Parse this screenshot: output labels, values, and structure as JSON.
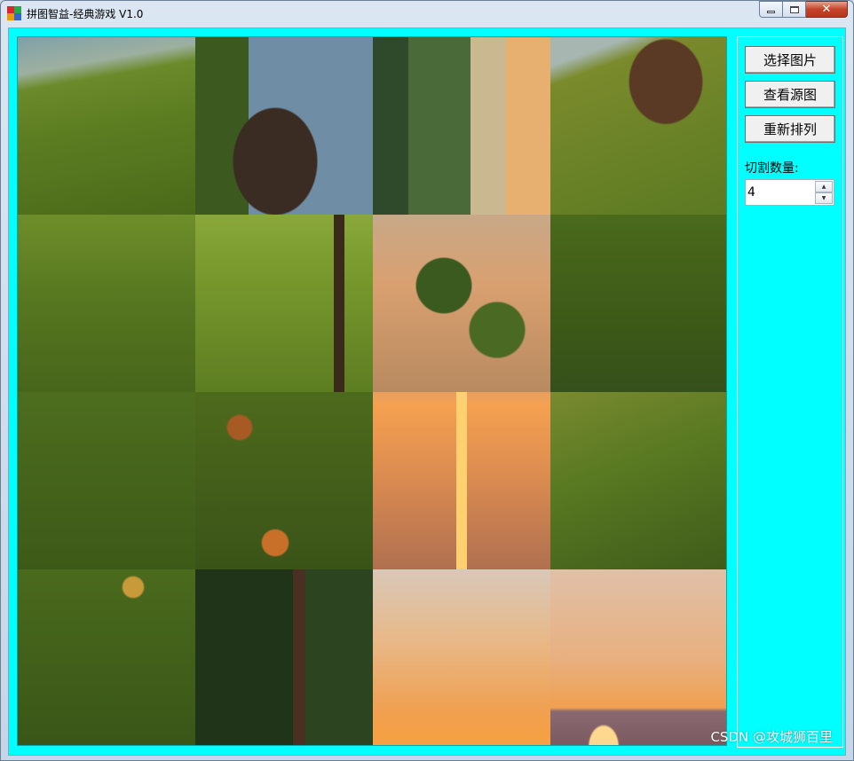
{
  "window": {
    "title": "拼图智益-经典游戏 V1.0",
    "close_glyph": "✕"
  },
  "side_panel": {
    "choose_image_label": "选择图片",
    "view_source_label": "查看源图",
    "reshuffle_label": "重新排列",
    "split_count_label": "切割数量:",
    "split_count_value": "4"
  },
  "board": {
    "grid_size": 4,
    "tile_scenes": [
      "lake-shore-grass",
      "rock-water",
      "trees-backlit",
      "slope-grass-rocks",
      "grass-field",
      "grass-field-tree",
      "leaves-over-water",
      "grass-closeup",
      "grass-leaves",
      "grass-dry-leaves",
      "sunset-reflection",
      "slope-grass-leaves",
      "grass-dusk",
      "forest-dark",
      "sunset-sky-tree",
      "sunset-mountains"
    ]
  },
  "colors": {
    "client_bg": "#00ffff",
    "grass_dark": "#3d5a1a",
    "grass_light": "#8aa83a",
    "sky_orange": "#f2a050",
    "water": "#6f8ea0"
  },
  "watermark": "CSDN @攻城狮百里"
}
